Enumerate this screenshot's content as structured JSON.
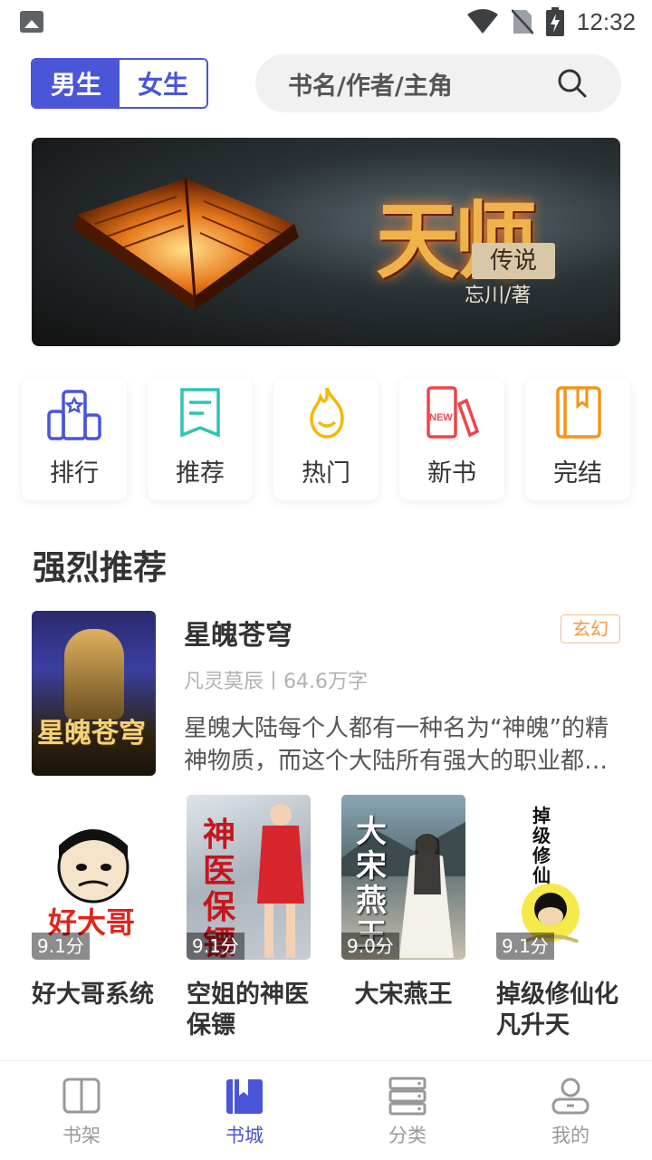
{
  "status": {
    "time": "12:32"
  },
  "gender": {
    "male": "男生",
    "female": "女生"
  },
  "search": {
    "placeholder": "书名/作者/主角"
  },
  "banner": {
    "title": "天师",
    "subtitle": "传说",
    "author": "忘川/著"
  },
  "categories": [
    {
      "label": "排行",
      "icon": "ranking-icon",
      "color": "#4a55d8"
    },
    {
      "label": "推荐",
      "icon": "recommend-icon",
      "color": "#2cc5b4"
    },
    {
      "label": "热门",
      "icon": "hot-icon",
      "color": "#f5b800"
    },
    {
      "label": "新书",
      "icon": "new-book-icon",
      "color": "#f0434b"
    },
    {
      "label": "完结",
      "icon": "finished-icon",
      "color": "#f29418"
    }
  ],
  "section": {
    "title": "强烈推荐"
  },
  "featured": {
    "title": "星魄苍穹",
    "tag": "玄幻",
    "meta": "凡灵莫辰丨64.6万字",
    "description": "星魄大陆每个人都有一种名为“神魄”的精神物质，而这个大陆所有强大的职业都…",
    "cover_text": "星魄苍穹"
  },
  "books": [
    {
      "title": "好大哥系统",
      "score": "9.1分",
      "cover_text": "好大哥"
    },
    {
      "title": "空姐的神医保镖",
      "score": "9.1分",
      "cover_text": "神医保镖"
    },
    {
      "title": "大宋燕王",
      "score": "9.0分",
      "cover_text": "大宋燕王"
    },
    {
      "title": "掉级修仙化凡升天",
      "score": "9.1分",
      "cover_text": "掉级修仙"
    }
  ],
  "tabs": [
    {
      "label": "书架",
      "icon": "bookshelf-icon"
    },
    {
      "label": "书城",
      "icon": "bookstore-icon"
    },
    {
      "label": "分类",
      "icon": "category-icon"
    },
    {
      "label": "我的",
      "icon": "profile-icon"
    }
  ],
  "colors": {
    "accent": "#4a55d8",
    "tag": "#ee9a3a"
  }
}
